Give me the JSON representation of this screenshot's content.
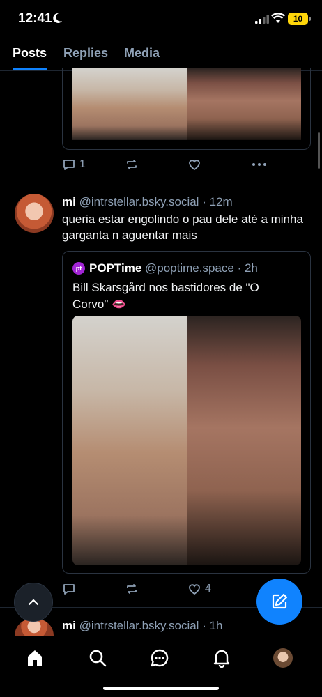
{
  "status_bar": {
    "time": "12:41",
    "battery": "10",
    "battery_color": "#ffd60a"
  },
  "tabs": [
    {
      "label": "Posts",
      "active": true
    },
    {
      "label": "Replies",
      "active": false
    },
    {
      "label": "Media",
      "active": false
    }
  ],
  "accent_color": "#1083fe",
  "previous_post": {
    "reply_count": "1"
  },
  "post": {
    "author_name": "mi",
    "handle": "@intrstellar.bsky.social",
    "time": "· 12m",
    "text": "queria estar engolindo o pau dele até a minha garganta n aguentar mais",
    "quote": {
      "avatar_label": "pt",
      "author_name": "POPTime",
      "handle": "@poptime.space",
      "time": "· 2h",
      "text": "Bill Skarsgård nos bastidores de \"O Corvo\" 👄"
    },
    "reply_count": "",
    "like_count": "4"
  },
  "next_post": {
    "author_name": "mi",
    "handle": "@intrstellar.bsky.social",
    "time": "· 1h"
  },
  "bottom_nav": [
    "home-icon",
    "search-icon",
    "chat-icon",
    "bell-icon",
    "profile-avatar"
  ]
}
